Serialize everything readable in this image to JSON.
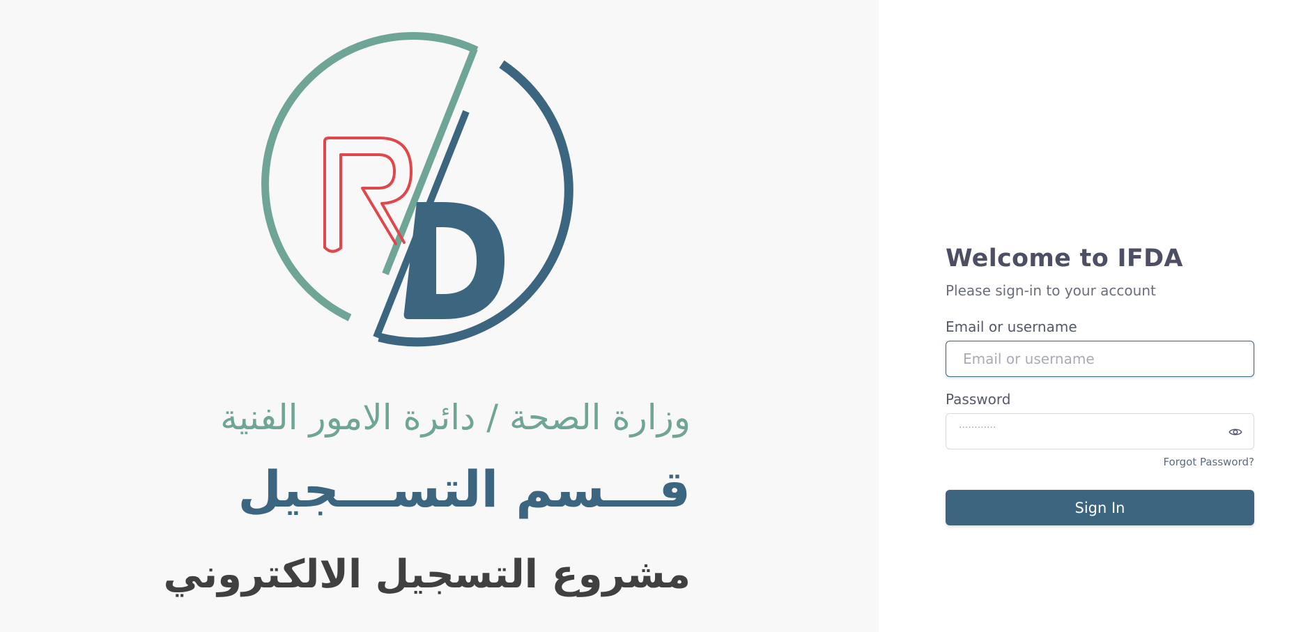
{
  "brand": {
    "logo_letters": "RD",
    "arabic_line1": "وزارة الصحة / دائرة الامور الفنية",
    "arabic_line2": "قـــسم التســـجيل",
    "arabic_line3": "مشروع التسجيل الالكتروني",
    "colors": {
      "teal": "#6fa596",
      "navy": "#3c6680",
      "red": "#e0474a",
      "dark": "#404040"
    }
  },
  "login": {
    "title": "Welcome to IFDA",
    "subtitle": "Please sign-in to your account",
    "email_label": "Email or username",
    "email_placeholder": "Email or username",
    "password_label": "Password",
    "password_mask": "············",
    "password_toggle_icon": "eye-icon",
    "forgot_label": "Forgot Password?",
    "signin_label": "Sign In"
  }
}
